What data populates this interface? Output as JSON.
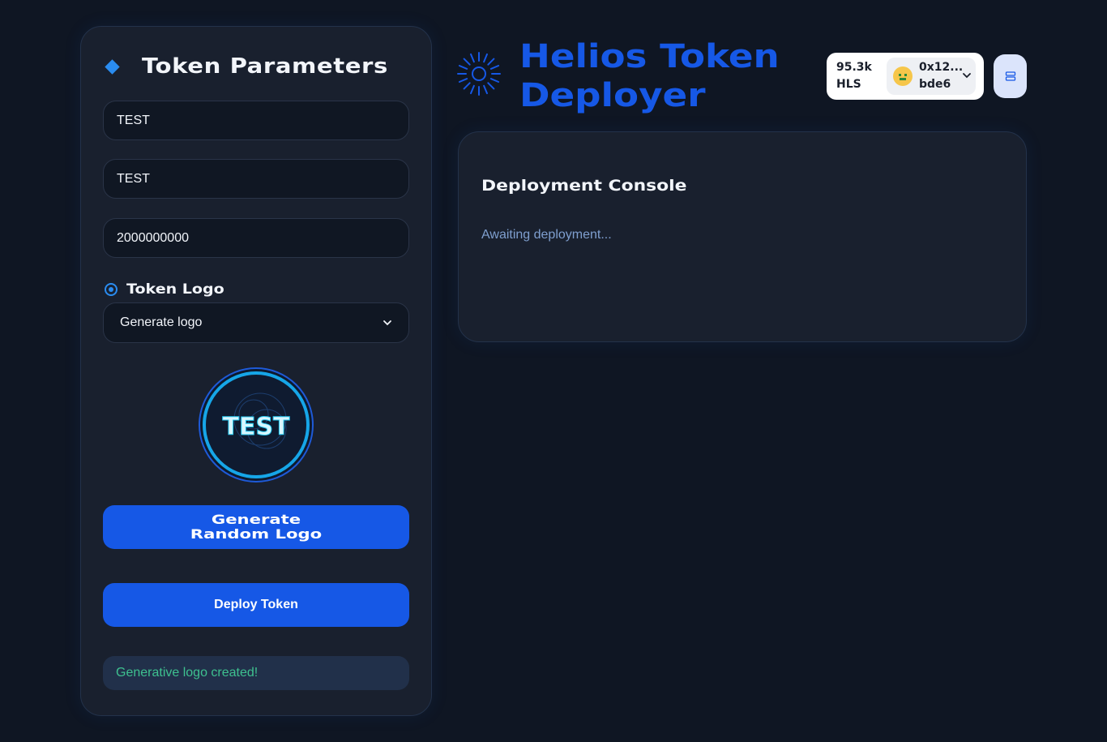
{
  "app": {
    "title": "Helios Token Deployer",
    "accent_color": "#1658e6"
  },
  "wallet": {
    "balance_amount": "95.3k",
    "balance_unit": "HLS",
    "address_line1": "0x12...",
    "address_line2": "bde6",
    "avatar_icon": "avatar-icon"
  },
  "menu": {
    "icon": "menu-icon"
  },
  "token_form": {
    "heading": "Token Parameters",
    "name_value": "TEST",
    "symbol_value": "TEST",
    "supply_value": "2000000000",
    "logo_label": "Token Logo",
    "logo_option_selected": "Generate logo",
    "logo_preview_text": "TEST",
    "generate_button_line1": "Generate",
    "generate_button_line2": "Random Logo",
    "deploy_button": "Deploy Token",
    "status_message": "Generative logo created!",
    "status_color": "#3ec08f"
  },
  "console": {
    "title": "Deployment Console",
    "log_text": "Awaiting deployment..."
  }
}
